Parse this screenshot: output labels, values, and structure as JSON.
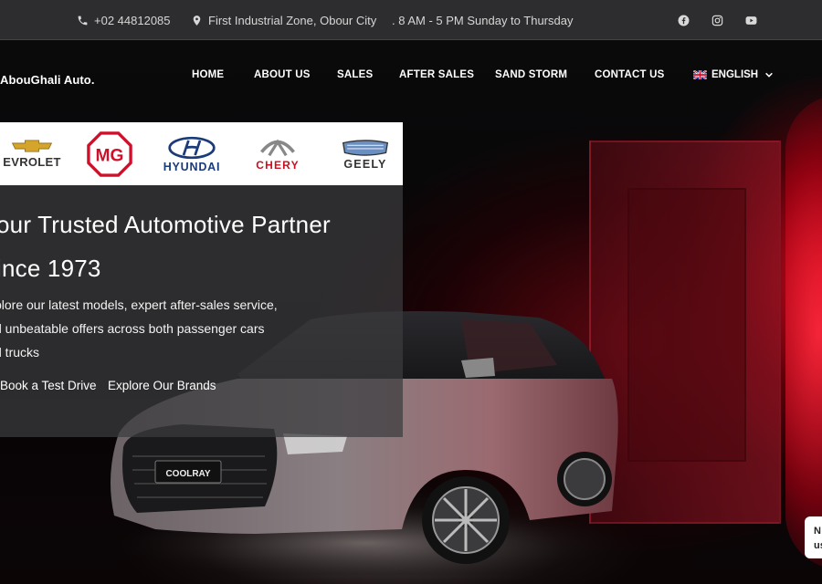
{
  "topbar": {
    "phone": "+02 44812085",
    "address": "First Industrial Zone, Obour City",
    "hours": ". 8 AM - 5 PM Sunday to Thursday",
    "social": [
      "facebook-icon",
      "instagram-icon",
      "youtube-icon"
    ]
  },
  "header": {
    "logo": "AbouGhali Auto.",
    "nav": [
      "HOME",
      "ABOUT US",
      "SALES",
      "AFTER SALES",
      "SAND STORM",
      "CONTACT US"
    ],
    "language": "ENGLISH"
  },
  "brands": {
    "chevrolet": "EVROLET",
    "mg": "MG",
    "hyundai": "HYUNDAI",
    "chery": "CHERY",
    "geely": "GEELY"
  },
  "hero": {
    "headline_line1": "our Trusted Automotive Partner",
    "headline_line2": "ince 1973",
    "desc_line1": "plore our latest models, expert after-sales service,",
    "desc_line2": "d unbeatable offers across both passenger cars",
    "desc_line3": "d trucks",
    "cta_test_drive": "Book a Test Drive",
    "cta_brands": "Explore Our Brands",
    "car_badge": "COOLRAY"
  },
  "widget": {
    "line1": "N",
    "line2": "us"
  },
  "colors": {
    "accent_red": "#d0102a",
    "topbar_bg": "#2d2d2f"
  }
}
